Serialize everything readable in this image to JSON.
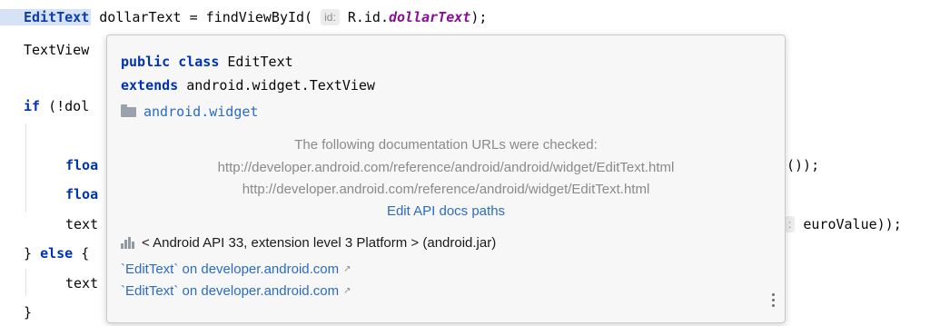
{
  "code": {
    "line1": {
      "type": "EditText",
      "var": "dollarText = findViewById(",
      "hint": "id:",
      "arg_prefix": "R.id.",
      "arg_field": "dollarText",
      "suffix": ");"
    },
    "line2": "TextView",
    "line3": {
      "kw": "if",
      "rest": "(!dol"
    },
    "line4": {
      "kw": "floa",
      "tail": "());"
    },
    "line5": {
      "kw": "floa"
    },
    "line6": {
      "text": "text",
      "hint": ":",
      "tail": "euroValue));"
    },
    "line7": {
      "brace": "}",
      "kw": "else",
      "rest": "{"
    },
    "line8": "text",
    "line9": "}"
  },
  "popup": {
    "sig_line1": {
      "kw": "public class",
      "name": "EditText"
    },
    "sig_line2": {
      "kw": "extends",
      "name": "android.widget.TextView"
    },
    "package": "android.widget",
    "note_heading": "The following documentation URLs were checked:",
    "urls": [
      "http://developer.android.com/reference/android/android/widget/EditText.html",
      "http://developer.android.com/reference/android/widget/EditText.html"
    ],
    "edit_paths_link": "Edit API docs paths",
    "api_level": "< Android API 33, extension level 3 Platform > (android.jar)",
    "doc_links": [
      "`EditText` on developer.android.com",
      "`EditText` on developer.android.com"
    ],
    "external_arrow": "↗",
    "icons": {
      "package": "folder-icon",
      "library": "library-icon",
      "more": "more-vertical-icon"
    }
  }
}
